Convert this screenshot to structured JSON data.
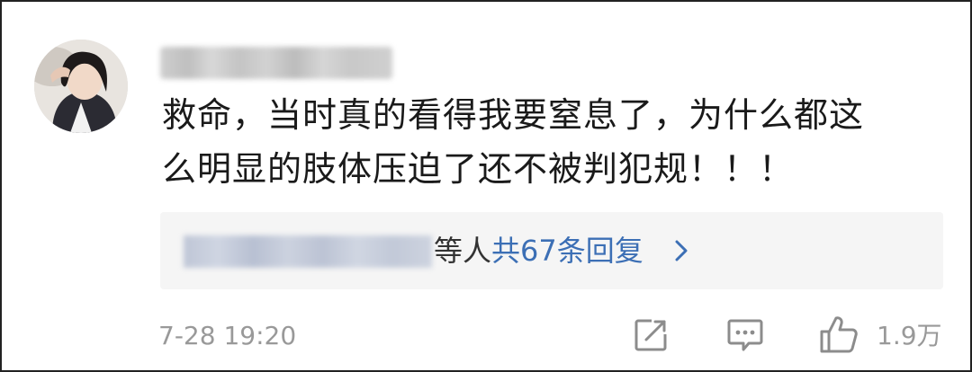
{
  "comment": {
    "text": "救命，当时真的看得我要窒息了，为什么都这\n么明显的肢体压迫了还不被判犯规！！！",
    "timestamp": "7-28 19:20"
  },
  "replies": {
    "suffix": "等人",
    "link_label": "共67条回复"
  },
  "actions": {
    "share_icon": "share-icon",
    "comment_icon": "comment-icon",
    "like_icon": "thumbs-up-icon",
    "like_count": "1.9万"
  },
  "colors": {
    "link": "#3c6fb5",
    "meta": "#999999",
    "reply_box_bg": "#f5f5f5"
  }
}
